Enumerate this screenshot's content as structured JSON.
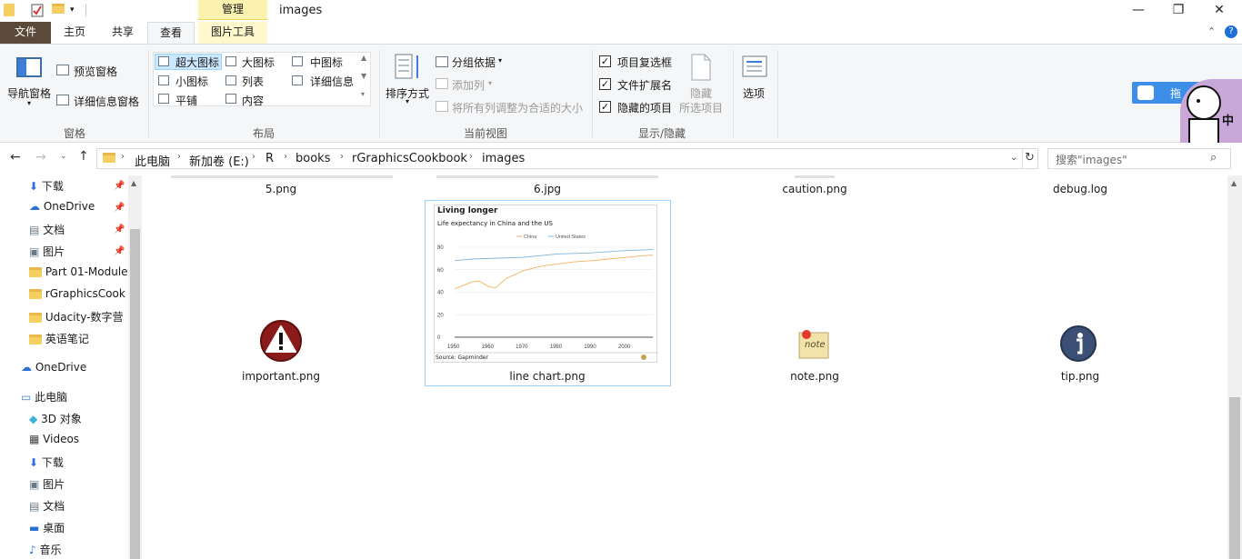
{
  "window": {
    "title": "images",
    "context_tab": "管理",
    "controls": [
      "—",
      "❐",
      "✕"
    ]
  },
  "ribbon_tabs": {
    "file": "文件",
    "home": "主页",
    "share": "共享",
    "view": "查看",
    "picture_tools": "图片工具"
  },
  "ribbon": {
    "panes": {
      "nav_pane": "导航窗格",
      "preview_pane": "预览窗格",
      "details_pane": "详细信息窗格",
      "group_label": "窗格"
    },
    "layout": {
      "xl_icons": "超大图标",
      "large_icons": "大图标",
      "medium_icons": "中图标",
      "small_icons": "小图标",
      "list": "列表",
      "details": "详细信息",
      "tiles": "平铺",
      "content": "内容",
      "group_label": "布局"
    },
    "current_view": {
      "sort_by": "排序方式",
      "group_by": "分组依据",
      "add_columns": "添加列",
      "size_all": "将所有列调整为合适的大小",
      "group_label": "当前视图"
    },
    "show_hide": {
      "item_checkboxes": "项目复选框",
      "file_extensions": "文件扩展名",
      "hidden_items": "隐藏的项目",
      "hide": "隐藏",
      "hide_selected": "所选项目",
      "group_label": "显示/隐藏"
    },
    "options": "选项"
  },
  "floating_widget": {
    "label": "拖",
    "ime_char": "中"
  },
  "address": {
    "crumbs": [
      "此电脑",
      "新加卷 (E:)",
      "R",
      "books",
      "rGraphicsCookbook",
      "images"
    ],
    "search_placeholder": "搜索\"images\""
  },
  "nav": {
    "quick": [
      {
        "label": "下载"
      },
      {
        "label": "OneDrive"
      },
      {
        "label": "文档"
      },
      {
        "label": "图片"
      },
      {
        "label": "Part 01-Module"
      },
      {
        "label": "rGraphicsCook"
      },
      {
        "label": "Udacity-数字营"
      },
      {
        "label": "英语笔记"
      }
    ],
    "onedrive": "OneDrive",
    "this_pc": "此电脑",
    "pc_items": [
      {
        "label": "3D 对象"
      },
      {
        "label": "Videos"
      },
      {
        "label": "下载"
      },
      {
        "label": "图片"
      },
      {
        "label": "文档"
      },
      {
        "label": "桌面"
      },
      {
        "label": "音乐"
      }
    ]
  },
  "files": {
    "row1": [
      "5.png",
      "6.jpg",
      "caution.png",
      "debug.log"
    ],
    "row2": [
      "important.png",
      "line chart.png",
      "note.png",
      "tip.png"
    ],
    "note_icon_text": "note"
  },
  "chart_data": {
    "type": "line",
    "title": "Living longer",
    "subtitle": "Life expectancy in China and the US",
    "source": "Source: Gapminder",
    "ylim": [
      0,
      80
    ],
    "yticks": [
      "0",
      "20",
      "40",
      "60",
      "80"
    ],
    "xlim": [
      1950,
      2008
    ],
    "xticks": [
      "1950",
      "1960",
      "1970",
      "1980",
      "1990",
      "2000"
    ],
    "legend_position": "top",
    "series": [
      {
        "name": "China",
        "color": "#f4b25f",
        "x": [
          1950,
          1955,
          1957,
          1960,
          1962,
          1965,
          1970,
          1975,
          1980,
          1985,
          1990,
          1995,
          2000,
          2005,
          2008
        ],
        "y": [
          43,
          49,
          50,
          45,
          44,
          52,
          59,
          63,
          65,
          67,
          68,
          69.5,
          71,
          72.5,
          73
        ]
      },
      {
        "name": "United States",
        "color": "#7fb5e0",
        "x": [
          1950,
          1955,
          1960,
          1965,
          1970,
          1975,
          1980,
          1985,
          1990,
          1995,
          2000,
          2005,
          2008
        ],
        "y": [
          68,
          69.5,
          70,
          70.5,
          71,
          72.5,
          74,
          74.5,
          75,
          76,
          77,
          77.5,
          78
        ]
      }
    ]
  }
}
